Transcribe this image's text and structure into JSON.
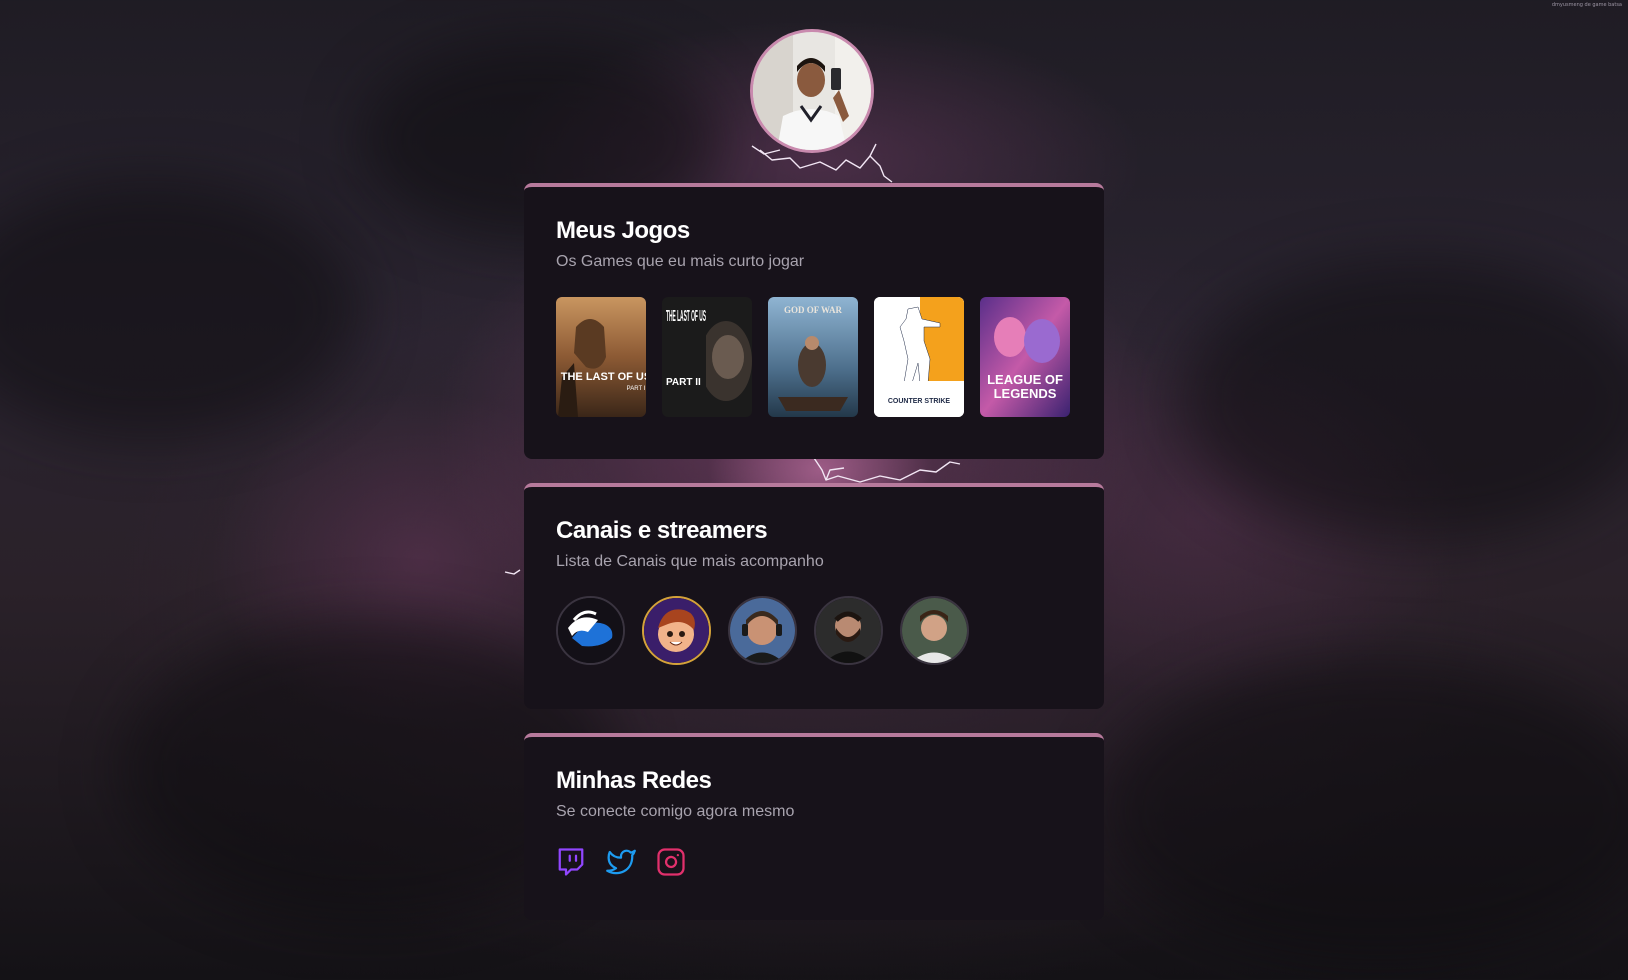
{
  "page": {
    "corner_note": "dmyusmeng de game batsa"
  },
  "profile": {
    "avatar_alt": "profile photo"
  },
  "games_section": {
    "title": "Meus Jogos",
    "subtitle": "Os Games que eu mais curto jogar",
    "games": [
      {
        "name": "The Last of Us Part I",
        "cover_text": "THE LAST OF US",
        "cover_sub": "PART I"
      },
      {
        "name": "The Last of Us Part II",
        "cover_text": "THE LAST OF US",
        "cover_sub": "PART II"
      },
      {
        "name": "God of War",
        "cover_text": "GOD OF WAR"
      },
      {
        "name": "Counter-Strike",
        "cover_text": "COUNTER STRIKE"
      },
      {
        "name": "League of Legends",
        "cover_text": "LEAGUE OF LEGENDS"
      }
    ]
  },
  "channels_section": {
    "title": "Canais e streamers",
    "subtitle": "Lista de Canais que mais acompanho",
    "channels": [
      {
        "icon": "winged-hat-logo"
      },
      {
        "icon": "cartoon-avatar"
      },
      {
        "icon": "streamer-headset-avatar"
      },
      {
        "icon": "bearded-man-avatar"
      },
      {
        "icon": "young-man-avatar"
      }
    ]
  },
  "social_section": {
    "title": "Minhas Redes",
    "subtitle": "Se conecte comigo agora mesmo",
    "links": [
      {
        "icon": "twitch-icon",
        "color": "#9146FF"
      },
      {
        "icon": "twitter-icon",
        "color": "#1D9BF0"
      },
      {
        "icon": "instagram-icon",
        "color": "#E1306C"
      }
    ]
  },
  "colors": {
    "card_background": "#17121a",
    "card_accent": "#b77a9c",
    "subtitle": "#a8a3ae"
  }
}
